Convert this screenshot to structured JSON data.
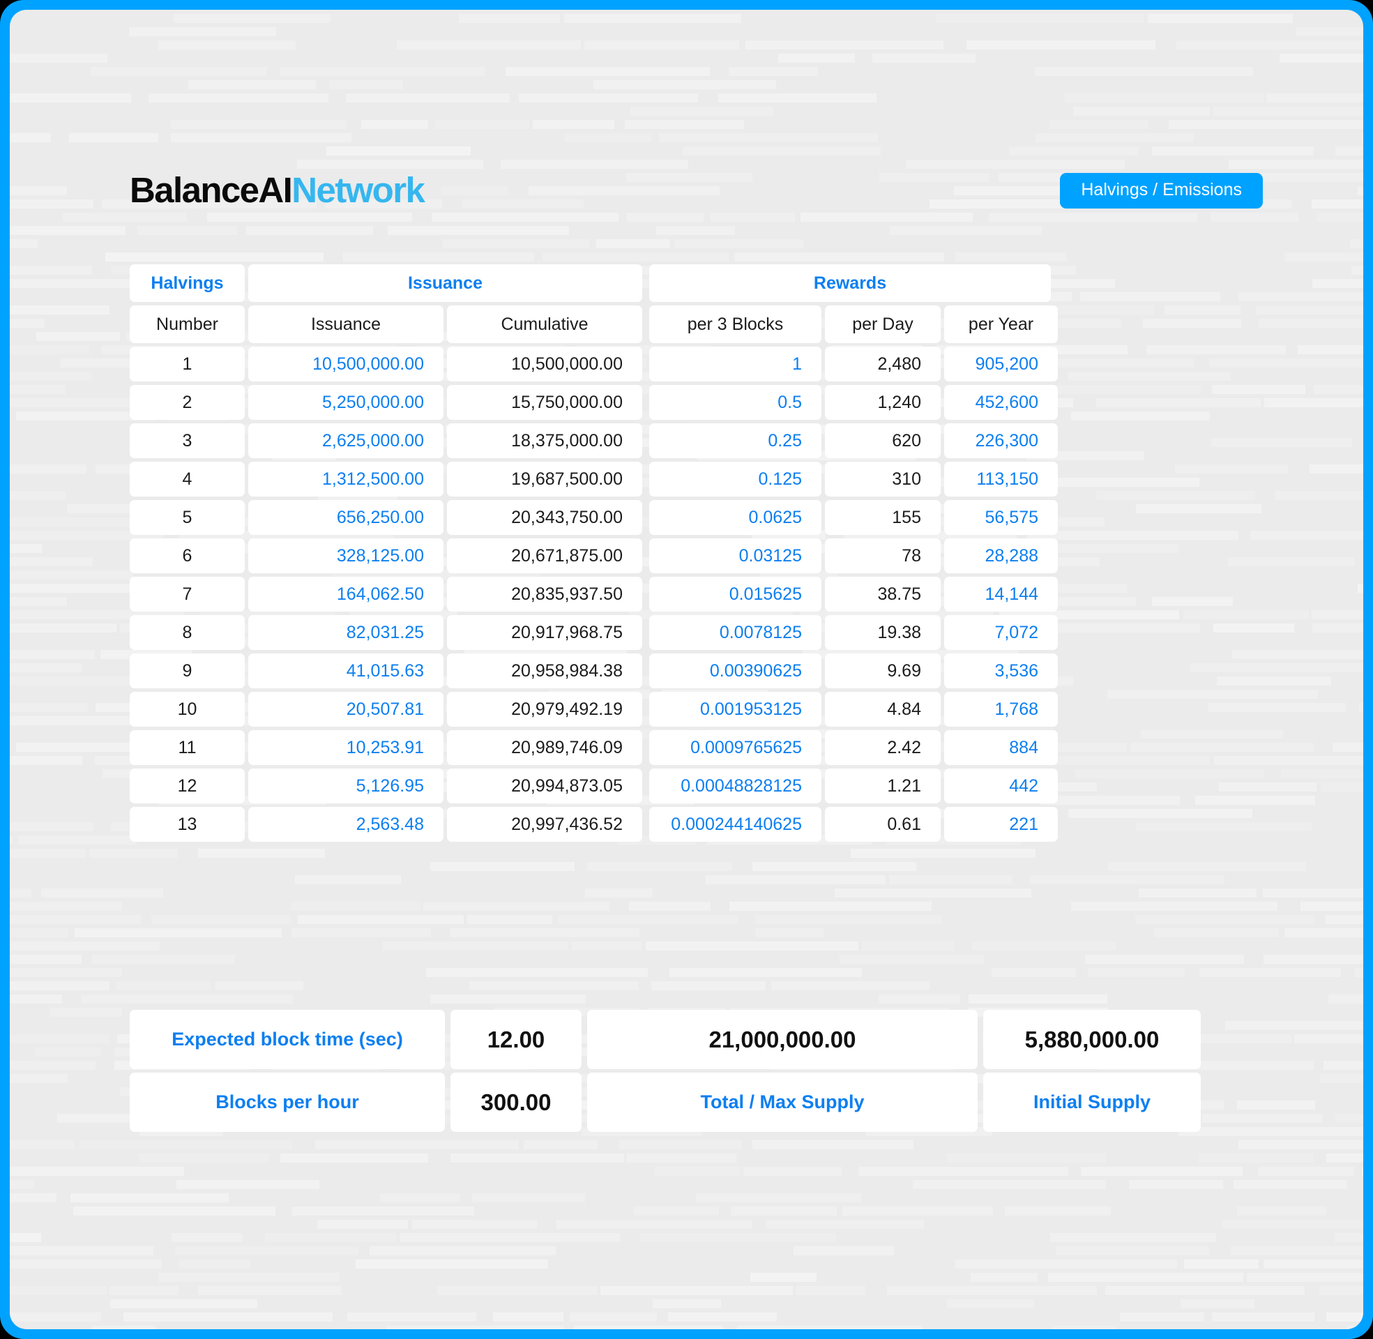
{
  "header": {
    "logo_primary": "BalanceAI",
    "logo_secondary": "Network",
    "badge_label": "Halvings / Emissions"
  },
  "colors": {
    "frame_blue": "#00a2ff",
    "accent_blue": "#0d7ff0",
    "logo_accent": "#35b6ef",
    "background": "#ebebeb",
    "cell_background": "#ffffff",
    "text_dark": "#1c1c1c"
  },
  "table": {
    "group_headers": [
      {
        "label": "Halvings"
      },
      {
        "label": "Issuance"
      },
      {
        "label": "Rewards"
      }
    ],
    "columns": [
      {
        "key": "number",
        "label": "Number"
      },
      {
        "key": "issuance",
        "label": "Issuance"
      },
      {
        "key": "cumulative",
        "label": "Cumulative"
      },
      {
        "key": "per_3_blocks",
        "label": "per 3 Blocks"
      },
      {
        "key": "per_day",
        "label": "per Day"
      },
      {
        "key": "per_year",
        "label": "per Year"
      }
    ],
    "rows": [
      {
        "number": "1",
        "issuance": "10,500,000.00",
        "cumulative": "10,500,000.00",
        "per_3_blocks": "1",
        "per_day": "2,480",
        "per_year": "905,200"
      },
      {
        "number": "2",
        "issuance": "5,250,000.00",
        "cumulative": "15,750,000.00",
        "per_3_blocks": "0.5",
        "per_day": "1,240",
        "per_year": "452,600"
      },
      {
        "number": "3",
        "issuance": "2,625,000.00",
        "cumulative": "18,375,000.00",
        "per_3_blocks": "0.25",
        "per_day": "620",
        "per_year": "226,300"
      },
      {
        "number": "4",
        "issuance": "1,312,500.00",
        "cumulative": "19,687,500.00",
        "per_3_blocks": "0.125",
        "per_day": "310",
        "per_year": "113,150"
      },
      {
        "number": "5",
        "issuance": "656,250.00",
        "cumulative": "20,343,750.00",
        "per_3_blocks": "0.0625",
        "per_day": "155",
        "per_year": "56,575"
      },
      {
        "number": "6",
        "issuance": "328,125.00",
        "cumulative": "20,671,875.00",
        "per_3_blocks": "0.03125",
        "per_day": "78",
        "per_year": "28,288"
      },
      {
        "number": "7",
        "issuance": "164,062.50",
        "cumulative": "20,835,937.50",
        "per_3_blocks": "0.015625",
        "per_day": "38.75",
        "per_year": "14,144"
      },
      {
        "number": "8",
        "issuance": "82,031.25",
        "cumulative": "20,917,968.75",
        "per_3_blocks": "0.0078125",
        "per_day": "19.38",
        "per_year": "7,072"
      },
      {
        "number": "9",
        "issuance": "41,015.63",
        "cumulative": "20,958,984.38",
        "per_3_blocks": "0.00390625",
        "per_day": "9.69",
        "per_year": "3,536"
      },
      {
        "number": "10",
        "issuance": "20,507.81",
        "cumulative": "20,979,492.19",
        "per_3_blocks": "0.001953125",
        "per_day": "4.84",
        "per_year": "1,768"
      },
      {
        "number": "11",
        "issuance": "10,253.91",
        "cumulative": "20,989,746.09",
        "per_3_blocks": "0.0009765625",
        "per_day": "2.42",
        "per_year": "884"
      },
      {
        "number": "12",
        "issuance": "5,126.95",
        "cumulative": "20,994,873.05",
        "per_3_blocks": "0.00048828125",
        "per_day": "1.21",
        "per_year": "442"
      },
      {
        "number": "13",
        "issuance": "2,563.48",
        "cumulative": "20,997,436.52",
        "per_3_blocks": "0.000244140625",
        "per_day": "0.61",
        "per_year": "221"
      }
    ]
  },
  "footer": {
    "block_time_label": "Expected block time (sec)",
    "block_time_value": "12.00",
    "total_supply_value": "21,000,000.00",
    "initial_supply_value": "5,880,000.00",
    "blocks_per_hour_label": "Blocks per hour",
    "blocks_per_hour_value": "300.00",
    "total_supply_label": "Total / Max Supply",
    "initial_supply_label": "Initial Supply"
  }
}
